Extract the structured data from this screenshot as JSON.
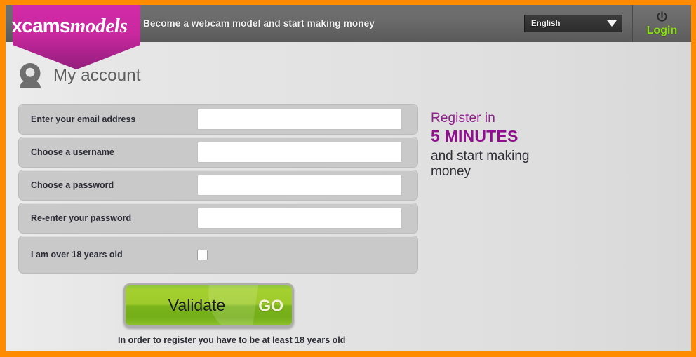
{
  "theme": {
    "border_color": "#ff8c00",
    "logo_magenta": "#c9289f",
    "login_green": "#88e011",
    "promo_purple": "#8f0f8f",
    "button_green": "#9ecb2b"
  },
  "header": {
    "logo_part1": "xcams",
    "logo_part2": "models",
    "tagline": "Become a webcam model and start making money",
    "language": {
      "selected": "English",
      "options": [
        "English"
      ]
    },
    "login_label": "Login"
  },
  "content": {
    "page_title": "My account"
  },
  "form": {
    "fields": [
      {
        "label": "Enter your email address",
        "value": "",
        "placeholder": "",
        "type": "email"
      },
      {
        "label": "Choose a username",
        "value": "",
        "placeholder": "",
        "type": "text"
      },
      {
        "label": "Choose a password",
        "value": "",
        "placeholder": "",
        "type": "password"
      },
      {
        "label": "Re-enter your password",
        "value": "",
        "placeholder": "",
        "type": "password"
      }
    ],
    "age_check": {
      "label": "I am over 18 years old",
      "checked": false
    },
    "submit_label": "Validate",
    "submit_badge": "GO",
    "footnote": "In order to register you have to be at least 18 years old"
  },
  "promo": {
    "line1": "Register in",
    "line2": "5 MINUTES",
    "line3": "and start making money"
  }
}
